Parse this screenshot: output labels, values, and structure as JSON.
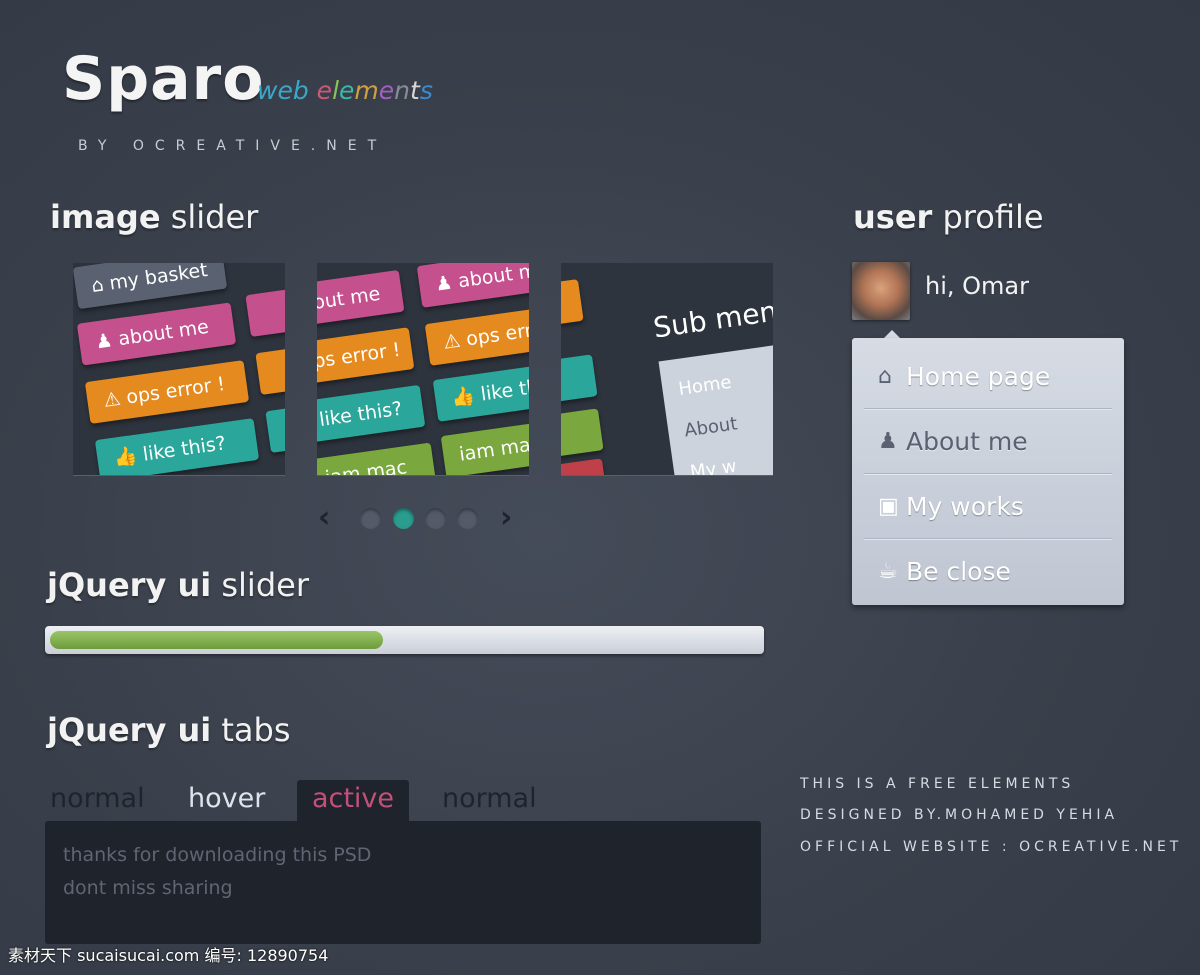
{
  "header": {
    "title": "Sparo",
    "subtitle": "web elements",
    "subtitle_colors": [
      "#3aa8c8",
      "#3aa8c8",
      "#3aa8c8",
      "#c85a78",
      "#8ac05a",
      "#3ab8a8",
      "#d0a040",
      "#a060c0",
      "#8a8a9a",
      "#d8d8d8",
      "#3a8ad0",
      "#c87050"
    ],
    "byline": "BY OCREATIVE.NET"
  },
  "image_slider": {
    "heading_bold": "image",
    "heading_rest": " slider",
    "panels": [
      {
        "buttons": [
          {
            "label": "my basket",
            "color": "#5a6272",
            "icon": "basket-icon"
          },
          {
            "label": "about me",
            "color": "#c4508e",
            "icon": "user-icon"
          },
          {
            "label": "ops error !",
            "color": "#e58a1e",
            "icon": "warning-icon"
          },
          {
            "label": "like this?",
            "color": "#2aa69a",
            "icon": "thumbs-up-icon"
          }
        ]
      },
      {
        "buttons": [
          {
            "label": "out me",
            "color": "#c4508e"
          },
          {
            "label": "about me",
            "color": "#c4508e",
            "icon": "user-icon"
          },
          {
            "label": "ps error !",
            "color": "#e58a1e"
          },
          {
            "label": "ops error",
            "color": "#e58a1e",
            "icon": "warning-icon"
          },
          {
            "label": "like this?",
            "color": "#2aa69a"
          },
          {
            "label": "like this",
            "color": "#2aa69a",
            "icon": "thumbs-up-icon"
          },
          {
            "label": "iam mac",
            "color": "#7aa83e"
          },
          {
            "label": "iam mac",
            "color": "#7aa83e",
            "icon": "apple-icon"
          }
        ]
      },
      {
        "title": "Sub men",
        "items": [
          "Home",
          "About",
          "My w"
        ]
      }
    ],
    "dots": 4,
    "active_dot": 1,
    "active_color": "#2a9d8f"
  },
  "ui_slider": {
    "heading_bold": "jQuery ui",
    "heading_rest": " slider",
    "value_percent": 47
  },
  "ui_tabs": {
    "heading_bold": "jQuery ui",
    "heading_rest": " tabs",
    "tabs": [
      {
        "label": "normal",
        "state": "normal"
      },
      {
        "label": "hover",
        "state": "hover"
      },
      {
        "label": "active",
        "state": "active"
      },
      {
        "label": "normal",
        "state": "normal"
      }
    ],
    "content": [
      "thanks for downloading this PSD",
      "dont miss sharing"
    ]
  },
  "user_profile": {
    "heading_bold": "user",
    "heading_rest": " profile",
    "greeting": "hi, Omar",
    "menu": [
      {
        "label": "Home page",
        "icon": "home-icon"
      },
      {
        "label": "About me",
        "icon": "user-icon"
      },
      {
        "label": "My works",
        "icon": "image-icon"
      },
      {
        "label": "Be close",
        "icon": "coffee-icon"
      }
    ]
  },
  "footer": [
    "THIS IS A FREE ELEMENTS",
    "DESIGNED BY.MOHAMED YEHIA",
    "OFFICIAL WEBSITE : OCREATIVE.NET"
  ],
  "watermark": "素材天下 sucaisucai.com  编号: 12890754"
}
